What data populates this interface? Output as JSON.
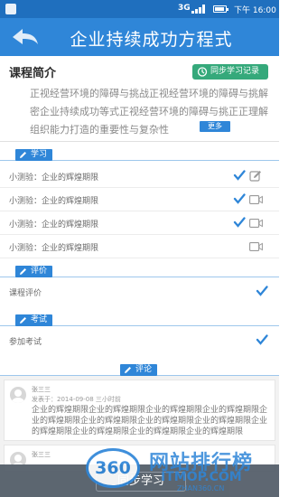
{
  "status_bar": {
    "network": "3G",
    "time": "下午 16:00"
  },
  "header": {
    "title": "企业持续成功方程式"
  },
  "intro": {
    "title": "课程简介",
    "sync_button": "同步学习记录",
    "text": "正视经营环境的障碍与挑战正视经营环境的障碍与挑解密企业持续成功等式正视经营环境的障碍与挑正正理解组织能力打造的重要性与复杂性",
    "more_button": "更多"
  },
  "sections": {
    "study": {
      "tab": "学习",
      "rows": [
        {
          "label": "小测验：企业的辉煌期限",
          "checked": true,
          "icon": "edit-icon"
        },
        {
          "label": "小测验：企业的辉煌期限",
          "checked": true,
          "icon": "video-icon"
        },
        {
          "label": "小测验：企业的辉煌期限",
          "checked": true,
          "icon": "video-icon"
        },
        {
          "label": "小测验：企业的辉煌期限",
          "checked": false,
          "icon": "video-icon"
        }
      ]
    },
    "evaluation": {
      "tab": "评价",
      "row_label": "课程评价"
    },
    "exam": {
      "tab": "考试",
      "row_label": "参加考试"
    },
    "comments": {
      "tab": "评论",
      "items": [
        {
          "name": "张三三",
          "meta": "发表于：2014-09-08  三小时前",
          "body": "企业的辉煌期限企业的辉煌期限企业的辉煌期限企业的辉煌期限企业的辉煌期限企业的辉煌期限企业的辉煌期限企业的辉煌期限企业的辉煌期限企业的辉煌期限企业的辉煌期限企业的辉煌期限"
        },
        {
          "name": "张三三",
          "meta": "",
          "body": ""
        }
      ]
    }
  },
  "bottom_bar": {
    "button": "同步学习"
  },
  "watermark": {
    "badge": "360",
    "line1": "网站排行榜",
    "line2": "ITMOP.COM",
    "line3": "ZHAN360.CN"
  },
  "colors": {
    "primary": "#2f86d8",
    "status_bar": "#1f6fbe",
    "sync_green": "#35a97b"
  }
}
